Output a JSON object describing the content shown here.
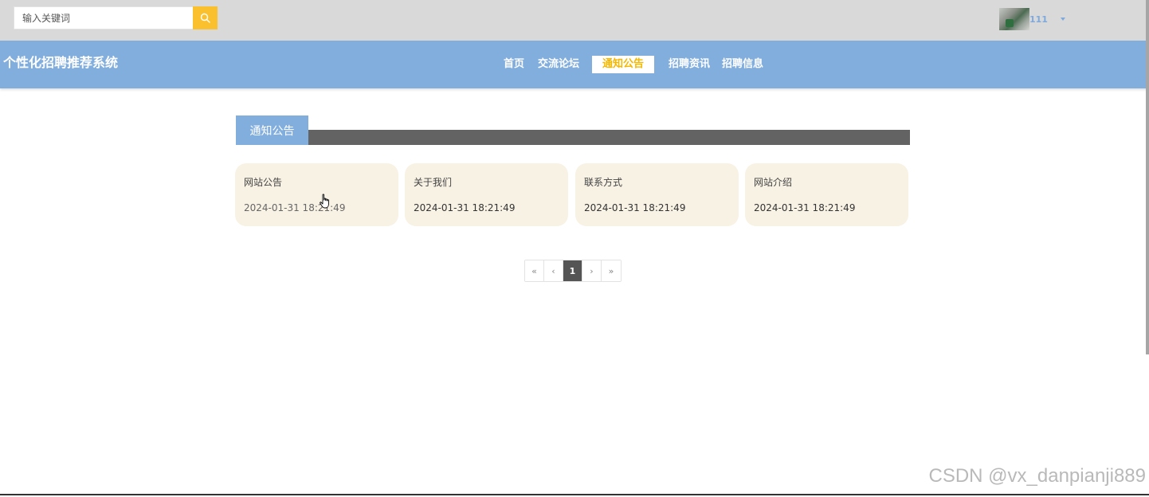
{
  "search": {
    "placeholder": "输入关键词",
    "icon": "search-icon"
  },
  "user": {
    "name": "111",
    "avatar": "avatar-photo"
  },
  "site": {
    "title": "个性化招聘推荐系统"
  },
  "nav": {
    "items": [
      {
        "label": "首页"
      },
      {
        "label": "交流论坛"
      },
      {
        "label": "通知公告",
        "active": true
      },
      {
        "label": "招聘资讯"
      },
      {
        "label": "招聘信息"
      }
    ]
  },
  "section": {
    "title": "通知公告"
  },
  "cards": [
    {
      "title": "网站公告",
      "date": "2024-01-31 18:21:49"
    },
    {
      "title": "关于我们",
      "date": "2024-01-31 18:21:49"
    },
    {
      "title": "联系方式",
      "date": "2024-01-31 18:21:49"
    },
    {
      "title": "网站介绍",
      "date": "2024-01-31 18:21:49"
    }
  ],
  "pagination": {
    "first": "«",
    "prev": "‹",
    "current": "1",
    "next": "›",
    "last": "»"
  },
  "watermark": "CSDN @vx_danpianji889",
  "colors": {
    "nav_bg": "#82aede",
    "topbar_bg": "#d9d9d9",
    "accent": "#fbc02d",
    "active_text": "#f5b800",
    "card_bg": "#f8f2e5",
    "section_bar": "#636363"
  }
}
